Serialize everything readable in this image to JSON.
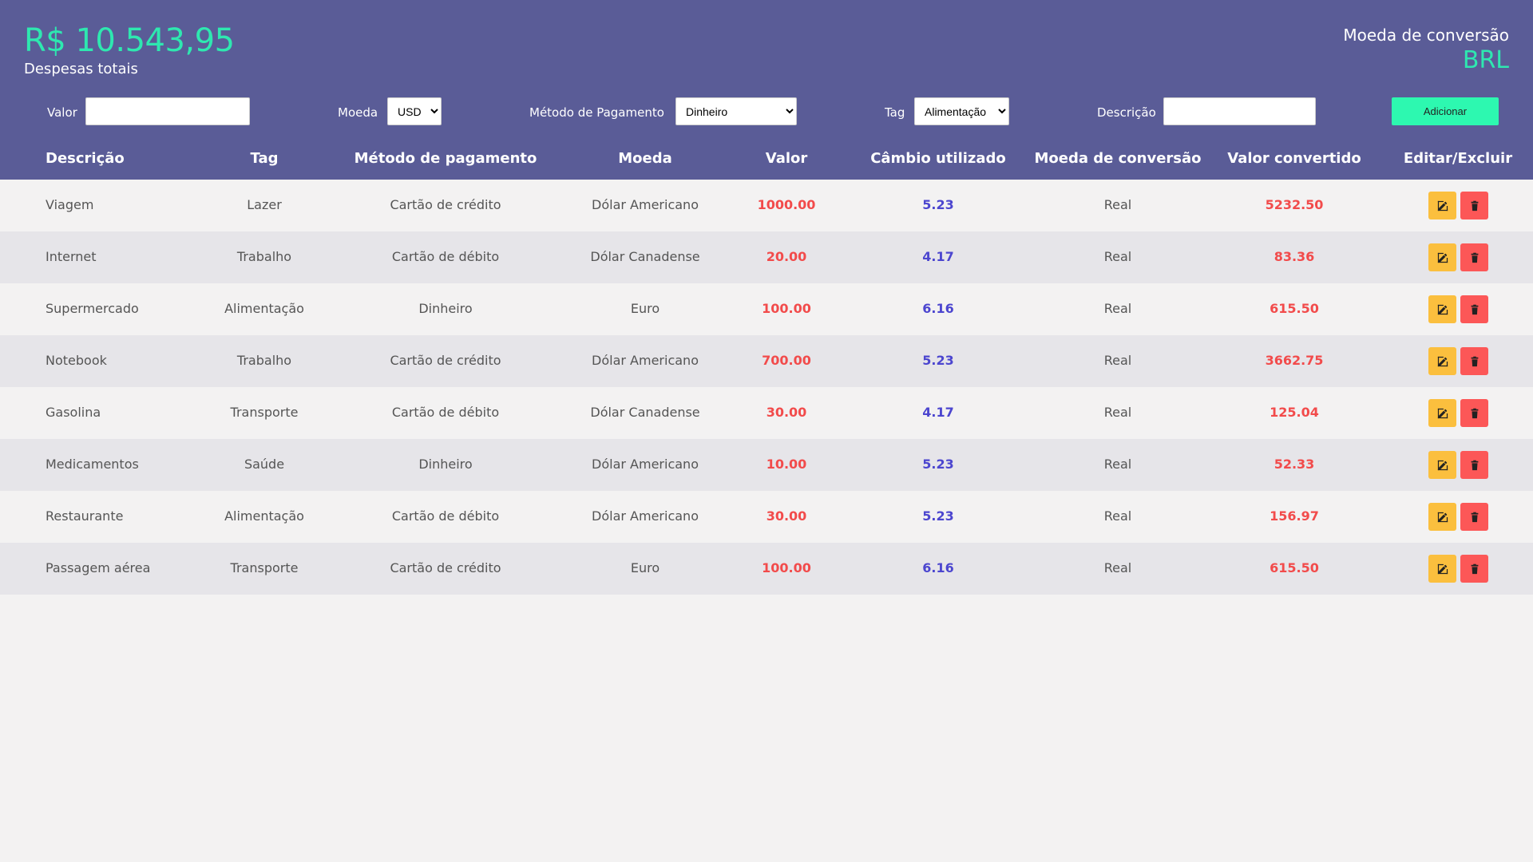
{
  "header": {
    "total_value": "R$ 10.543,95",
    "total_label": "Despesas totais",
    "conversion_label": "Moeda de conversão",
    "conversion_value": "BRL"
  },
  "form": {
    "valor_label": "Valor",
    "valor_value": "",
    "moeda_label": "Moeda",
    "moeda_selected": "USD",
    "metodo_label": "Método de Pagamento",
    "metodo_selected": "Dinheiro",
    "tag_label": "Tag",
    "tag_selected": "Alimentação",
    "descricao_label": "Descrição",
    "descricao_value": "",
    "add_label": "Adicionar"
  },
  "table": {
    "headers": {
      "descricao": "Descrição",
      "tag": "Tag",
      "metodo": "Método de pagamento",
      "moeda": "Moeda",
      "valor": "Valor",
      "cambio": "Câmbio utilizado",
      "moeda_conversao": "Moeda de conversão",
      "valor_convertido": "Valor convertido",
      "acoes": "Editar/Excluir"
    },
    "rows": [
      {
        "descricao": "Viagem",
        "tag": "Lazer",
        "metodo": "Cartão de crédito",
        "moeda": "Dólar Americano",
        "valor": "1000.00",
        "cambio": "5.23",
        "moeda_conversao": "Real",
        "valor_convertido": "5232.50"
      },
      {
        "descricao": "Internet",
        "tag": "Trabalho",
        "metodo": "Cartão de débito",
        "moeda": "Dólar Canadense",
        "valor": "20.00",
        "cambio": "4.17",
        "moeda_conversao": "Real",
        "valor_convertido": "83.36"
      },
      {
        "descricao": "Supermercado",
        "tag": "Alimentação",
        "metodo": "Dinheiro",
        "moeda": "Euro",
        "valor": "100.00",
        "cambio": "6.16",
        "moeda_conversao": "Real",
        "valor_convertido": "615.50"
      },
      {
        "descricao": "Notebook",
        "tag": "Trabalho",
        "metodo": "Cartão de crédito",
        "moeda": "Dólar Americano",
        "valor": "700.00",
        "cambio": "5.23",
        "moeda_conversao": "Real",
        "valor_convertido": "3662.75"
      },
      {
        "descricao": "Gasolina",
        "tag": "Transporte",
        "metodo": "Cartão de débito",
        "moeda": "Dólar Canadense",
        "valor": "30.00",
        "cambio": "4.17",
        "moeda_conversao": "Real",
        "valor_convertido": "125.04"
      },
      {
        "descricao": "Medicamentos",
        "tag": "Saúde",
        "metodo": "Dinheiro",
        "moeda": "Dólar Americano",
        "valor": "10.00",
        "cambio": "5.23",
        "moeda_conversao": "Real",
        "valor_convertido": "52.33"
      },
      {
        "descricao": "Restaurante",
        "tag": "Alimentação",
        "metodo": "Cartão de débito",
        "moeda": "Dólar Americano",
        "valor": "30.00",
        "cambio": "5.23",
        "moeda_conversao": "Real",
        "valor_convertido": "156.97"
      },
      {
        "descricao": "Passagem aérea",
        "tag": "Transporte",
        "metodo": "Cartão de crédito",
        "moeda": "Euro",
        "valor": "100.00",
        "cambio": "6.16",
        "moeda_conversao": "Real",
        "valor_convertido": "615.50"
      }
    ]
  },
  "icons": {
    "edit": "edit-icon",
    "delete": "trash-icon"
  },
  "colors": {
    "header_bg": "#5a5c97",
    "accent": "#2ee8b0",
    "value_red": "#f24b4b",
    "rate_blue": "#4c46cf",
    "edit_button": "#fbbf3e",
    "delete_button": "#fc5757"
  }
}
